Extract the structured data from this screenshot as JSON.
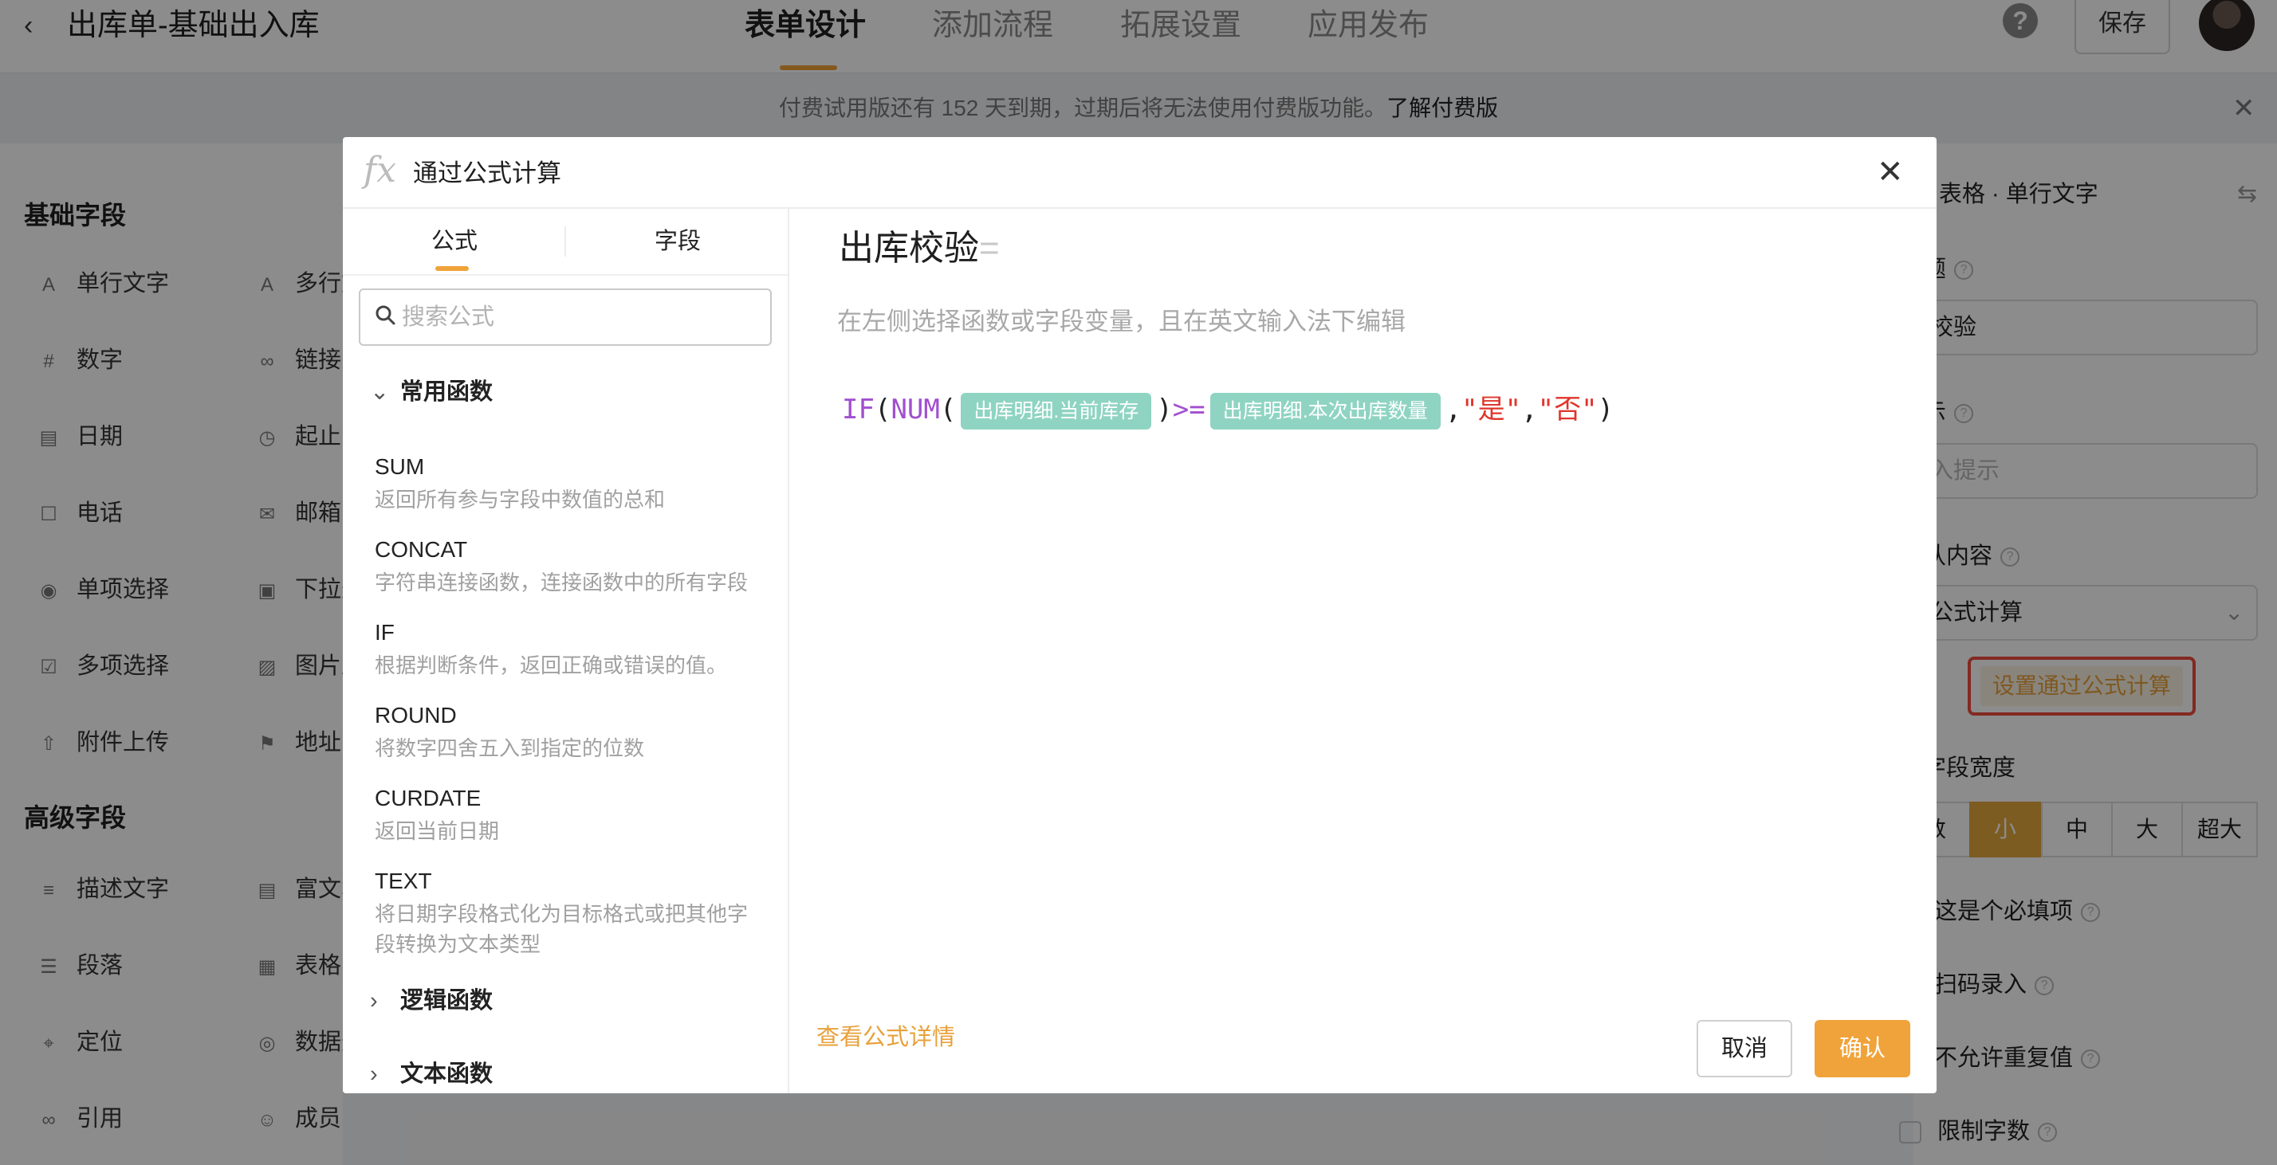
{
  "header": {
    "title": "出库单-基础出入库",
    "tabs": [
      "表单设计",
      "添加流程",
      "拓展设置",
      "应用发布"
    ],
    "save_label": "保存"
  },
  "banner": {
    "text": "付费试用版还有 152 天到期，过期后将无法使用付费版功能。",
    "link": "了解付费版"
  },
  "left_panel": {
    "basic_title": "基础字段",
    "basic_col1": [
      "单行文字",
      "数字",
      "日期",
      "电话",
      "单项选择",
      "多项选择",
      "附件上传"
    ],
    "basic_col2": [
      "多行文",
      "链接",
      "起止时",
      "邮箱",
      "下拉选",
      "图片上",
      "地址"
    ],
    "advanced_title": "高级字段",
    "adv_col1": [
      "描述文字",
      "段落",
      "定位",
      "引用"
    ],
    "adv_col2": [
      "富文本",
      "表格",
      "数据选",
      "成员"
    ]
  },
  "right_panel": {
    "header": "表格 · 单行文字",
    "label_title": "题",
    "label_value": "库校验",
    "hint_title": "示",
    "hint_placeholder": "输入提示",
    "default_title": "认内容",
    "default_value": "过公式计算",
    "set_formula_button": "设置通过公式计算",
    "width_title": "字段宽度",
    "width_options": [
      "数",
      "小",
      "中",
      "大",
      "超大"
    ],
    "width_selected": "小",
    "options": [
      "这是个必填项",
      "扫码录入",
      "不允许重复值"
    ],
    "limit_label": "限制字数"
  },
  "modal": {
    "title": "通过公式计算",
    "side_tabs": [
      "公式",
      "字段"
    ],
    "search_placeholder": "搜索公式",
    "categories": {
      "common": "常用函数",
      "logic": "逻辑函数",
      "text": "文本函数"
    },
    "functions": [
      {
        "name": "SUM",
        "desc": "返回所有参与字段中数值的总和"
      },
      {
        "name": "CONCAT",
        "desc": "字符串连接函数，连接函数中的所有字段"
      },
      {
        "name": "IF",
        "desc": "根据判断条件，返回正确或错误的值。"
      },
      {
        "name": "ROUND",
        "desc": "将数字四舍五入到指定的位数"
      },
      {
        "name": "CURDATE",
        "desc": "返回当前日期"
      },
      {
        "name": "TEXT",
        "desc": "将日期字段格式化为目标格式或把其他字段转换为文本类型"
      }
    ],
    "field_name": "出库校验",
    "field_eq": "=",
    "editor_hint": "在左侧选择函数或字段变量，且在英文输入法下编辑",
    "formula": {
      "if": "IF",
      "lp1": "(",
      "num": "NUM",
      "lp2": "(",
      "field1": "出库明细.当前库存",
      "rp1": ")",
      "ge": ">=",
      "field2": "出库明细.本次出库数量",
      "comma1": ",",
      "yes": "\"是\"",
      "comma2": ",",
      "no": "\"否\"",
      "rp2": ")"
    },
    "detail_link": "查看公式详情",
    "cancel_label": "取消",
    "ok_label": "确认"
  },
  "colors": {
    "accent": "#f0a33a",
    "tag": "#8fd4c2",
    "keyword": "#a14fd0",
    "string": "#e0352b",
    "highlight_border": "#ef4b3f"
  }
}
